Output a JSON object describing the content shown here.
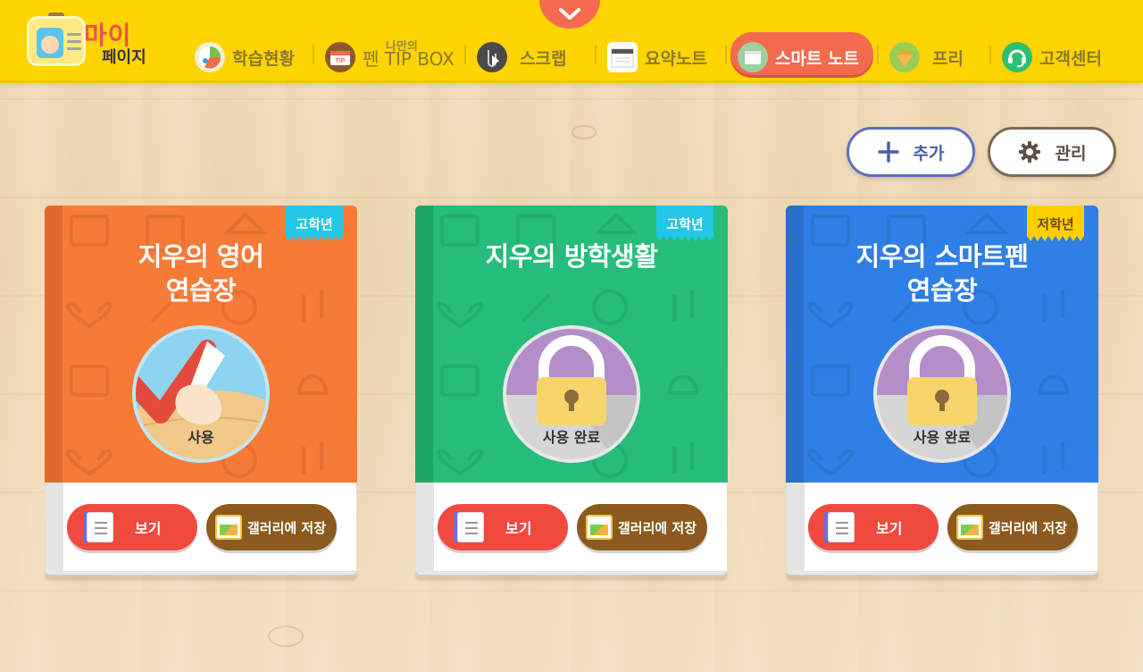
{
  "header": {
    "logo": {
      "line1": "마이",
      "line2": "페이지"
    },
    "nav": [
      {
        "label": "학습현황",
        "icon": "progress-icon"
      },
      {
        "label": "펜 TIP BOX",
        "small": "나만의",
        "icon": "tip-box-icon"
      },
      {
        "label": "스크랩",
        "icon": "scrap-icon"
      },
      {
        "label": "요약노트",
        "icon": "summary-note-icon"
      },
      {
        "label": "스마트 노트",
        "icon": "smart-note-icon",
        "active": true
      },
      {
        "label": "프리",
        "icon": "free-icon"
      },
      {
        "label": "고객센터",
        "icon": "customer-center-icon"
      }
    ]
  },
  "actions": {
    "add_label": "추가",
    "manage_label": "관리"
  },
  "notebooks": [
    {
      "title": "지우의 영어\n연습장",
      "grade": "고학년",
      "status": "사용",
      "color": "#f77a37",
      "spine": "#e06a2c",
      "tag_color": "#22c6e6",
      "locked": false,
      "view_label": "보기",
      "gallery_label": "갤러리에 저장"
    },
    {
      "title": "지우의 방학생활",
      "grade": "고학년",
      "status": "사용 완료",
      "color": "#25bd79",
      "spine": "#1ea868",
      "tag_color": "#22c6e6",
      "locked": true,
      "view_label": "보기",
      "gallery_label": "갤러리에 저장"
    },
    {
      "title": "지우의 스마트펜\n연습장",
      "grade": "저학년",
      "status": "사용 완료",
      "color": "#2f7fe6",
      "spine": "#2a6fcc",
      "tag_color": "#ffcf00",
      "locked": true,
      "view_label": "보기",
      "gallery_label": "갤러리에 저장"
    }
  ]
}
